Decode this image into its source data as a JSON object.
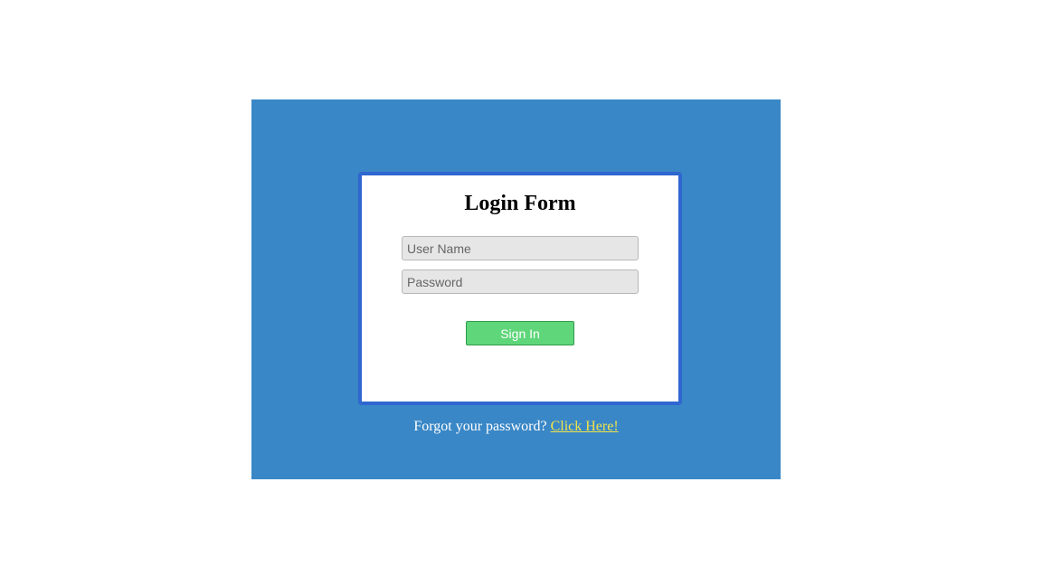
{
  "form": {
    "title": "Login Form",
    "username_placeholder": "User Name",
    "password_placeholder": "Password",
    "signin_label": "Sign In"
  },
  "footer": {
    "forgot_text": "Forgot your password?",
    "link_text": "Click Here!"
  },
  "colors": {
    "page_background": "#ffffff",
    "panel_background": "#3987c6",
    "card_border": "#2f66d0",
    "input_background": "#e6e6e6",
    "button_background": "#5fd67a",
    "link_color": "#f2e34a"
  }
}
